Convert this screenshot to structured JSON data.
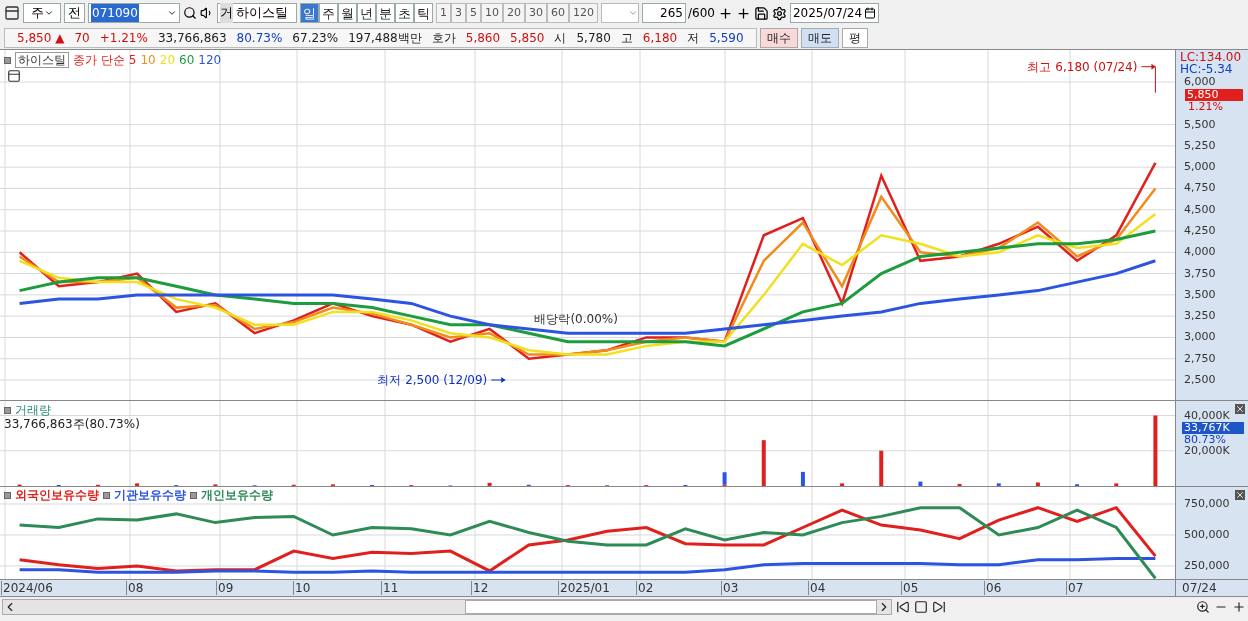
{
  "toolbar": {
    "market": "주",
    "prev": "전",
    "code": "071090",
    "name_prefix": "거",
    "name": "하이스틸",
    "periods": [
      {
        "label": "일",
        "selected": true
      },
      {
        "label": "주",
        "selected": false
      },
      {
        "label": "월",
        "selected": false
      },
      {
        "label": "년",
        "selected": false
      },
      {
        "label": "분",
        "selected": false
      },
      {
        "label": "초",
        "selected": false
      },
      {
        "label": "틱",
        "selected": false
      }
    ],
    "intervals": [
      "1",
      "3",
      "5",
      "10",
      "20",
      "30",
      "60",
      "120"
    ],
    "count": "265",
    "count_max": "/600",
    "date": "2025/07/24"
  },
  "quote": [
    {
      "text": "5,850 ▲",
      "color": "#d01010"
    },
    {
      "text": "70",
      "color": "#d01010"
    },
    {
      "text": "+1.21%",
      "color": "#d01010"
    },
    {
      "text": "33,766,863"
    },
    {
      "text": "80.73%",
      "color": "#1040c0"
    },
    {
      "text": "67.23%"
    },
    {
      "text": "197,488백만"
    },
    {
      "text": "호가"
    },
    {
      "text": "5,860",
      "color": "#d01010"
    },
    {
      "text": "5,850",
      "color": "#d01010"
    },
    {
      "text": "시"
    },
    {
      "text": "5,780"
    },
    {
      "text": "고"
    },
    {
      "text": "6,180",
      "color": "#d01010"
    },
    {
      "text": "저"
    },
    {
      "text": "5,590",
      "color": "#1040c0"
    }
  ],
  "trade_buttons": [
    {
      "label": "매수",
      "kind": "buy"
    },
    {
      "label": "매도",
      "kind": "sell"
    },
    {
      "label": "평",
      "kind": "plain"
    }
  ],
  "price_panel": {
    "stock_tag": "하이스틸",
    "ma_prefix": "종가 단순",
    "lc": "LC:134.00",
    "hc": "HC:-5.34",
    "current_price": "5,850",
    "current_change": "1.21%",
    "markers": [
      {
        "text": "최고 6,180 (07/24)",
        "kind": "high"
      },
      {
        "text": "최저 2,500 (12/09)",
        "kind": "low"
      },
      {
        "text": "배당락(0.00%)",
        "kind": "note"
      }
    ],
    "chart_data": {
      "type": "line",
      "categories": [
        null,
        null,
        null,
        null,
        null,
        null,
        null,
        null,
        null,
        null,
        null,
        null,
        null,
        null,
        null,
        null,
        null,
        null,
        null,
        null,
        null,
        null,
        null,
        null,
        null,
        null,
        null,
        null,
        null,
        null
      ],
      "ylim": [
        2265,
        6376
      ],
      "grid": true,
      "yticks": [
        {
          "value": 2500,
          "label": "2,500"
        },
        {
          "value": 2750,
          "label": "2,750"
        },
        {
          "value": 3000,
          "label": "3,000"
        },
        {
          "value": 3250,
          "label": "3,250"
        },
        {
          "value": 3500,
          "label": "3,500"
        },
        {
          "value": 3750,
          "label": "3,750"
        },
        {
          "value": 4000,
          "label": "4,000"
        },
        {
          "value": 4250,
          "label": "4,250"
        },
        {
          "value": 4500,
          "label": "4,500"
        },
        {
          "value": 4750,
          "label": "4,750"
        },
        {
          "value": 5000,
          "label": "5,000"
        },
        {
          "value": 5250,
          "label": "5,250"
        },
        {
          "value": 5500,
          "label": "5,500"
        },
        {
          "value": 6000,
          "label": "6,000"
        }
      ],
      "series": [
        {
          "name": "5",
          "color": "#e0201c",
          "values": [
            4000,
            3600,
            3650,
            3750,
            3300,
            3400,
            3050,
            3200,
            3400,
            3250,
            3150,
            2950,
            3100,
            2750,
            2800,
            2850,
            3000,
            3000,
            2950,
            4200,
            4400,
            3400,
            4900,
            3900,
            3950,
            4100,
            4300,
            3900,
            4200,
            5050
          ]
        },
        {
          "name": "10",
          "color": "#f08c1c",
          "values": [
            3950,
            3650,
            3650,
            3700,
            3350,
            3380,
            3100,
            3180,
            3350,
            3280,
            3150,
            3000,
            3050,
            2800,
            2800,
            2850,
            2950,
            3000,
            2950,
            3900,
            4350,
            3600,
            4650,
            4000,
            3950,
            4050,
            4350,
            3950,
            4150,
            4750
          ]
        },
        {
          "name": "20",
          "color": "#f0e020",
          "values": [
            3900,
            3700,
            3650,
            3650,
            3450,
            3350,
            3150,
            3150,
            3300,
            3300,
            3200,
            3050,
            3000,
            2850,
            2800,
            2800,
            2900,
            2950,
            2950,
            3500,
            4100,
            3850,
            4200,
            4100,
            3950,
            4000,
            4200,
            4050,
            4100,
            4450
          ]
        },
        {
          "name": "60",
          "color": "#1c9c3c",
          "values": [
            3550,
            3650,
            3700,
            3700,
            3600,
            3500,
            3450,
            3400,
            3400,
            3350,
            3250,
            3150,
            3150,
            3050,
            2950,
            2950,
            2950,
            2950,
            2900,
            3100,
            3300,
            3400,
            3750,
            3950,
            4000,
            4050,
            4100,
            4100,
            4150,
            4250
          ]
        },
        {
          "name": "120",
          "color": "#2c54e0",
          "values": [
            3400,
            3450,
            3450,
            3500,
            3500,
            3500,
            3500,
            3500,
            3500,
            3450,
            3400,
            3250,
            3150,
            3100,
            3050,
            3050,
            3050,
            3050,
            3100,
            3150,
            3200,
            3250,
            3300,
            3400,
            3450,
            3500,
            3550,
            3650,
            3750,
            3900
          ]
        }
      ]
    }
  },
  "volume_panel": {
    "title": "거래량",
    "summary": "33,766,863주(80.73%)",
    "current": "33,767K",
    "ratio": "80.73%",
    "chart_data": {
      "type": "bar",
      "categories": [
        null,
        null,
        null,
        null,
        null,
        null,
        null,
        null,
        null,
        null,
        null,
        null,
        null,
        null,
        null,
        null,
        null,
        null,
        null,
        null,
        null,
        null,
        null,
        null,
        null,
        null,
        null,
        null,
        null,
        null
      ],
      "ylim": [
        0,
        48235
      ],
      "stacked": true,
      "grid": true,
      "yticks": [
        {
          "value": 20000,
          "label": "20,000K"
        },
        {
          "value": 40000,
          "label": "40,000K"
        }
      ],
      "series": [
        {
          "color": "#e0201c",
          "values": [
            800,
            null,
            700,
            1500,
            null,
            900,
            null,
            700,
            900,
            null,
            500,
            null,
            1800,
            null,
            500,
            null,
            500,
            null,
            800,
            26000,
            null,
            1500,
            20000,
            null,
            1200,
            null,
            2000,
            null,
            1500,
            40000
          ]
        },
        {
          "color": "#2c54e0",
          "values": [
            null,
            600,
            null,
            null,
            500,
            null,
            400,
            null,
            null,
            600,
            null,
            300,
            null,
            700,
            null,
            400,
            null,
            600,
            7000,
            null,
            8000,
            null,
            null,
            2500,
            null,
            1500,
            null,
            1000,
            null,
            null
          ]
        }
      ]
    }
  },
  "holdings_panel": {
    "chart_data": {
      "type": "line",
      "categories": [
        null,
        null,
        null,
        null,
        null,
        null,
        null,
        null,
        null,
        null,
        null,
        null,
        null,
        null,
        null,
        null,
        null,
        null,
        null,
        null,
        null,
        null,
        null,
        null,
        null,
        null,
        null,
        null,
        null,
        null
      ],
      "ylim": [
        145000,
        887000
      ],
      "grid": true,
      "yticks": [
        {
          "value": 250000,
          "label": "250,000"
        },
        {
          "value": 500000,
          "label": "500,000"
        },
        {
          "value": 750000,
          "label": "750,000"
        }
      ],
      "series": [
        {
          "name": "외국인보유수량",
          "color": "#e0201c",
          "values": [
            300000,
            260000,
            230000,
            250000,
            210000,
            220000,
            220000,
            370000,
            310000,
            360000,
            350000,
            370000,
            210000,
            420000,
            460000,
            530000,
            560000,
            430000,
            420000,
            420000,
            560000,
            700000,
            580000,
            540000,
            470000,
            620000,
            720000,
            610000,
            720000,
            330000
          ]
        },
        {
          "name": "기관보유수량",
          "color": "#2c54e0",
          "values": [
            220000,
            220000,
            200000,
            200000,
            200000,
            210000,
            210000,
            200000,
            200000,
            210000,
            200000,
            200000,
            200000,
            200000,
            200000,
            200000,
            200000,
            200000,
            220000,
            260000,
            270000,
            270000,
            270000,
            270000,
            260000,
            260000,
            300000,
            300000,
            310000,
            310000
          ]
        },
        {
          "name": "개인보유수량",
          "color": "#2e8b57",
          "values": [
            580000,
            560000,
            630000,
            620000,
            670000,
            600000,
            640000,
            650000,
            500000,
            560000,
            550000,
            500000,
            610000,
            520000,
            450000,
            420000,
            420000,
            550000,
            460000,
            520000,
            500000,
            600000,
            650000,
            720000,
            720000,
            500000,
            560000,
            700000,
            560000,
            150000
          ]
        }
      ]
    }
  },
  "date_axis": [
    "2024/06",
    "08",
    "09",
    "10",
    "11",
    "12",
    "2025/01",
    "02",
    "03",
    "04",
    "05",
    "06",
    "07"
  ],
  "date_current": "07/24"
}
